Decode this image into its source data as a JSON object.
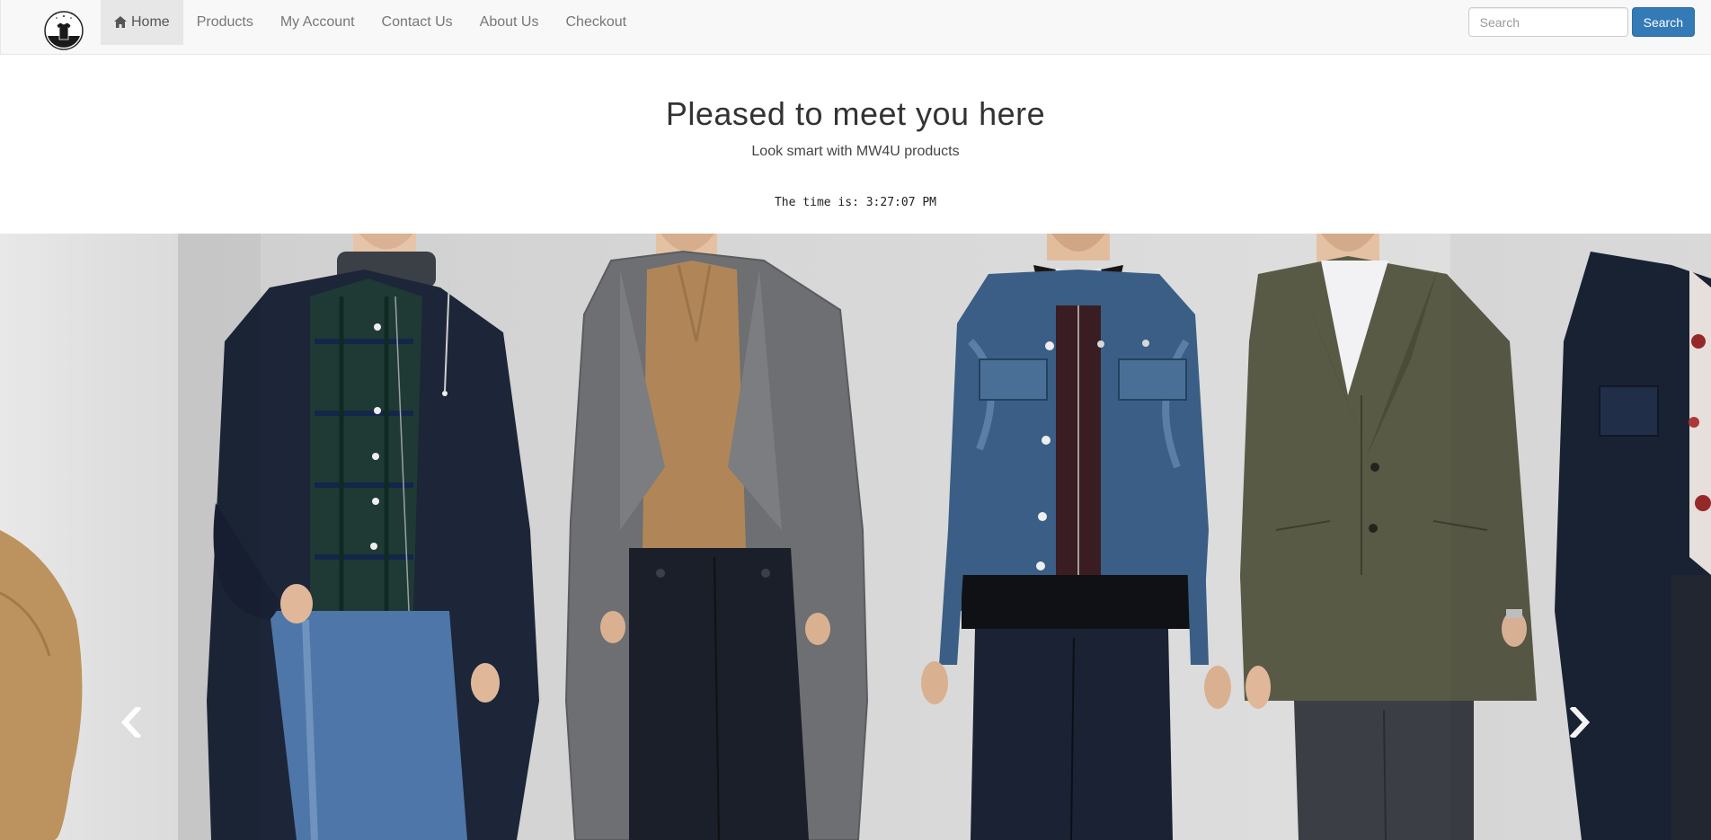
{
  "navbar": {
    "logo_icon": "shirt-logo-icon",
    "items": [
      {
        "label": "Home",
        "icon": "home-icon",
        "active": true
      },
      {
        "label": "Products"
      },
      {
        "label": "My Account"
      },
      {
        "label": "Contact Us"
      },
      {
        "label": "About Us"
      },
      {
        "label": "Checkout"
      }
    ],
    "search": {
      "placeholder": "Search",
      "button_label": "Search"
    }
  },
  "hero": {
    "title": "Pleased to meet you here",
    "subtitle": "Look smart with MW4U products",
    "clock_text": "The time is: 3:27:07 PM"
  },
  "carousel": {
    "prev_icon": "chevron-left-icon",
    "next_icon": "chevron-right-icon"
  },
  "colors": {
    "navbar_bg": "#f8f8f8",
    "active_nav_bg": "#e7e7e7",
    "primary_button": "#337ab7"
  }
}
